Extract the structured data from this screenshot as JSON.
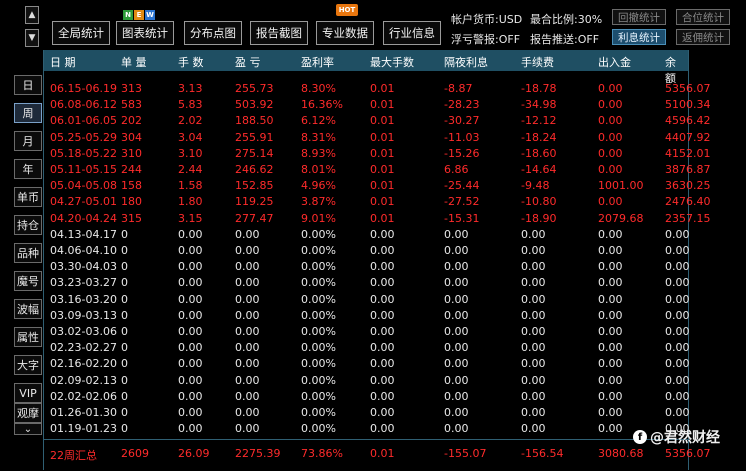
{
  "toolbar": {
    "up_arrow": "▲",
    "down_arrow": "▼",
    "buttons": [
      "全局统计",
      "图表统计",
      "分布点图",
      "报告截图",
      "专业数据",
      "行业信息"
    ],
    "new_badge": [
      "N",
      "E",
      "W"
    ],
    "hot_badge": "HOT",
    "info": {
      "currency": "帐户货币:USD",
      "max_ratio": "最合比例:30%",
      "float_alert": "浮亏警报:OFF",
      "report_push": "报告推送:OFF"
    },
    "small_buttons": [
      "回撤统计",
      "合位统计",
      "利息统计",
      "返佣统计"
    ]
  },
  "sidebar": {
    "items": [
      "日",
      "周",
      "月",
      "年",
      "单币",
      "持仓",
      "品种",
      "魔号",
      "波幅",
      "属性",
      "大字",
      "VIP",
      "观摩"
    ],
    "selected": "周",
    "more_icon": "⌄"
  },
  "table": {
    "headers": [
      "日 期",
      "单 量",
      "手 数",
      "盈 亏",
      "盈利率",
      "最大手数",
      "隔夜利息",
      "手续费",
      "出入金",
      "余 额"
    ],
    "rows": [
      [
        "06.15-06.19",
        "313",
        "3.13",
        "255.73",
        "8.30%",
        "0.01",
        "-8.87",
        "-18.78",
        "0.00",
        "5356.07"
      ],
      [
        "06.08-06.12",
        "583",
        "5.83",
        "503.92",
        "16.36%",
        "0.01",
        "-28.23",
        "-34.98",
        "0.00",
        "5100.34"
      ],
      [
        "06.01-06.05",
        "202",
        "2.02",
        "188.50",
        "6.12%",
        "0.01",
        "-30.27",
        "-12.12",
        "0.00",
        "4596.42"
      ],
      [
        "05.25-05.29",
        "304",
        "3.04",
        "255.91",
        "8.31%",
        "0.01",
        "-11.03",
        "-18.24",
        "0.00",
        "4407.92"
      ],
      [
        "05.18-05.22",
        "310",
        "3.10",
        "275.14",
        "8.93%",
        "0.01",
        "-15.26",
        "-18.60",
        "0.00",
        "4152.01"
      ],
      [
        "05.11-05.15",
        "244",
        "2.44",
        "246.62",
        "8.01%",
        "0.01",
        "6.86",
        "-14.64",
        "0.00",
        "3876.87"
      ],
      [
        "05.04-05.08",
        "158",
        "1.58",
        "152.85",
        "4.96%",
        "0.01",
        "-25.44",
        "-9.48",
        "1001.00",
        "3630.25"
      ],
      [
        "04.27-05.01",
        "180",
        "1.80",
        "119.25",
        "3.87%",
        "0.01",
        "-27.52",
        "-10.80",
        "0.00",
        "2476.40"
      ],
      [
        "04.20-04.24",
        "315",
        "3.15",
        "277.47",
        "9.01%",
        "0.01",
        "-15.31",
        "-18.90",
        "2079.68",
        "2357.15"
      ],
      [
        "04.13-04.17",
        "0",
        "0.00",
        "0.00",
        "0.00%",
        "0.00",
        "0.00",
        "0.00",
        "0.00",
        "0.00"
      ],
      [
        "04.06-04.10",
        "0",
        "0.00",
        "0.00",
        "0.00%",
        "0.00",
        "0.00",
        "0.00",
        "0.00",
        "0.00"
      ],
      [
        "03.30-04.03",
        "0",
        "0.00",
        "0.00",
        "0.00%",
        "0.00",
        "0.00",
        "0.00",
        "0.00",
        "0.00"
      ],
      [
        "03.23-03.27",
        "0",
        "0.00",
        "0.00",
        "0.00%",
        "0.00",
        "0.00",
        "0.00",
        "0.00",
        "0.00"
      ],
      [
        "03.16-03.20",
        "0",
        "0.00",
        "0.00",
        "0.00%",
        "0.00",
        "0.00",
        "0.00",
        "0.00",
        "0.00"
      ],
      [
        "03.09-03.13",
        "0",
        "0.00",
        "0.00",
        "0.00%",
        "0.00",
        "0.00",
        "0.00",
        "0.00",
        "0.00"
      ],
      [
        "03.02-03.06",
        "0",
        "0.00",
        "0.00",
        "0.00%",
        "0.00",
        "0.00",
        "0.00",
        "0.00",
        "0.00"
      ],
      [
        "02.23-02.27",
        "0",
        "0.00",
        "0.00",
        "0.00%",
        "0.00",
        "0.00",
        "0.00",
        "0.00",
        "0.00"
      ],
      [
        "02.16-02.20",
        "0",
        "0.00",
        "0.00",
        "0.00%",
        "0.00",
        "0.00",
        "0.00",
        "0.00",
        "0.00"
      ],
      [
        "02.09-02.13",
        "0",
        "0.00",
        "0.00",
        "0.00%",
        "0.00",
        "0.00",
        "0.00",
        "0.00",
        "0.00"
      ],
      [
        "02.02-02.06",
        "0",
        "0.00",
        "0.00",
        "0.00%",
        "0.00",
        "0.00",
        "0.00",
        "0.00",
        "0.00"
      ],
      [
        "01.26-01.30",
        "0",
        "0.00",
        "0.00",
        "0.00%",
        "0.00",
        "0.00",
        "0.00",
        "0.00",
        "0.00"
      ],
      [
        "01.19-01.23",
        "0",
        "0.00",
        "0.00",
        "0.00%",
        "0.00",
        "0.00",
        "0.00",
        "0.00",
        "0.00"
      ]
    ],
    "summary": [
      "22周汇总",
      "2609",
      "26.09",
      "2275.39",
      "73.86%",
      "0.01",
      "-155.07",
      "-156.54",
      "3080.68",
      "5356.07"
    ]
  },
  "colors": {
    "profit_red": "#ff2b2b",
    "header_bg": "#1f4f63",
    "active_button": "#1d4e6e"
  },
  "watermark": {
    "icon": "f",
    "text": "@君然财经"
  }
}
